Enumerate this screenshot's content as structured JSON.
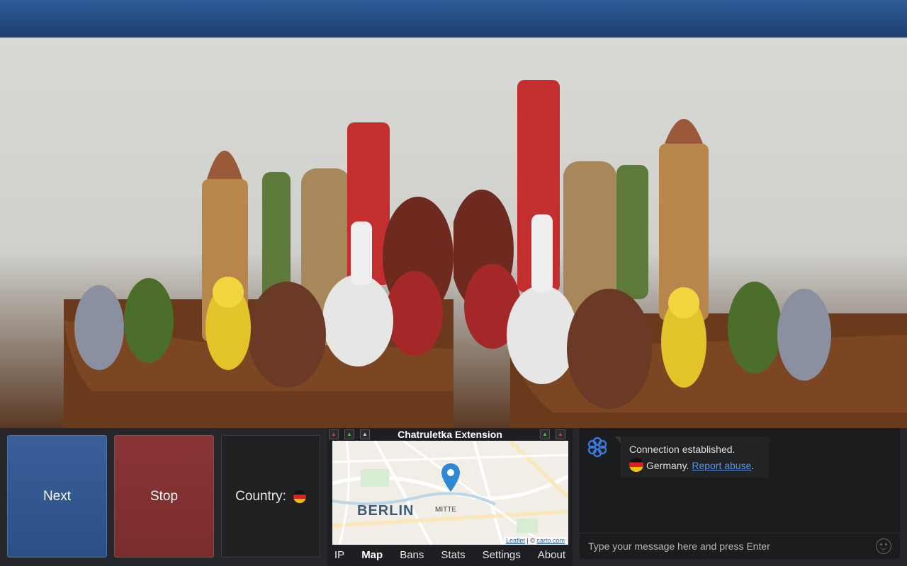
{
  "colors": {
    "topbar": "#2a5590",
    "next": "#345a95",
    "stop": "#833131",
    "panel": "#1d1f22",
    "link": "#5a93e0"
  },
  "buttons": {
    "next_label": "Next",
    "stop_label": "Stop",
    "country_label": "Country:"
  },
  "country_flag": "germany-flag",
  "extension": {
    "title": "Chatruletka Extension",
    "map": {
      "city_label": "BERLIN",
      "district_label": "MITTE",
      "attribution_link1": "Leaflet",
      "attribution_sep": " | © ",
      "attribution_link2": "carto.com"
    },
    "tabs": [
      "IP",
      "Map",
      "Bans",
      "Stats",
      "Settings",
      "About"
    ],
    "active_tab": "Map"
  },
  "chat": {
    "message_line1": "Connection established.",
    "message_country": "Germany.",
    "report_link": "Report abuse",
    "report_suffix": ".",
    "input_placeholder": "Type your message here and press Enter"
  }
}
